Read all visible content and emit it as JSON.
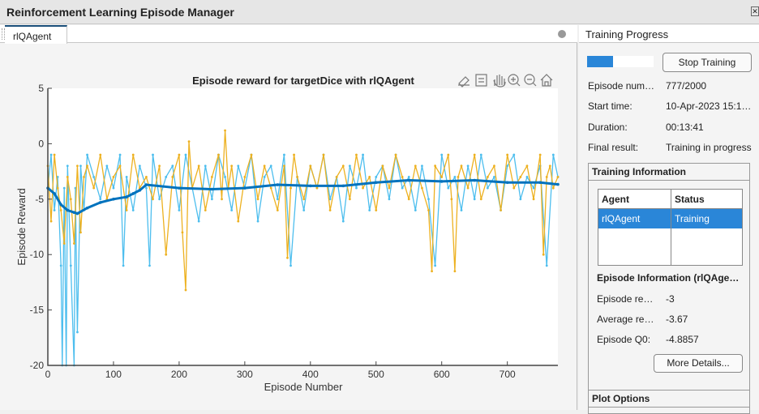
{
  "window": {
    "title": "Reinforcement Learning Episode Manager"
  },
  "tabs": [
    {
      "label": "rlQAgent",
      "active": true
    }
  ],
  "toolbar_icons": [
    "brush-icon",
    "legend-icon",
    "pan-hand-icon",
    "zoom-in-icon",
    "zoom-out-icon",
    "home-icon"
  ],
  "training_progress": {
    "header": "Training Progress",
    "progress_percent": 38.85,
    "stop_label": "Stop Training",
    "fields": [
      {
        "label": "Episode num…",
        "value": "777/2000"
      },
      {
        "label": "Start time:",
        "value": "10-Apr-2023 15:1…"
      },
      {
        "label": "Duration:",
        "value": "00:13:41"
      },
      {
        "label": "Final result:",
        "value": "Training in progress"
      }
    ],
    "training_information": {
      "header": "Training Information",
      "columns": [
        "Agent",
        "Status"
      ],
      "rows": [
        {
          "agent": "rlQAgent",
          "status": "Training",
          "selected": true
        }
      ],
      "episode_info_header": "Episode Information (rlQAge…",
      "episode_fields": [
        {
          "label": "Episode re…",
          "value": "-3"
        },
        {
          "label": "Average re…",
          "value": "-3.67"
        },
        {
          "label": "Episode Q0:",
          "value": "-4.8857"
        }
      ],
      "more_details_label": "More Details..."
    },
    "plot_options_header": "Plot Options"
  },
  "chart_data": {
    "type": "line",
    "title": "Episode reward for targetDice with rlQAgent",
    "xlabel": "Episode Number",
    "ylabel": "Episode Reward",
    "xlim": [
      0,
      777
    ],
    "ylim": [
      -20,
      5
    ],
    "xticks": [
      0,
      100,
      200,
      300,
      400,
      500,
      600,
      700
    ],
    "yticks": [
      -20,
      -15,
      -10,
      -5,
      0,
      5
    ],
    "grid": false,
    "colors": {
      "episode_reward": "#4dbeee",
      "average_reward": "#0072bd",
      "episode_q0": "#edb120"
    },
    "series": [
      {
        "key": "episode_reward",
        "x": [
          0,
          5,
          10,
          15,
          20,
          22,
          25,
          28,
          30,
          35,
          40,
          42,
          45,
          50,
          55,
          60,
          70,
          80,
          90,
          100,
          110,
          115,
          120,
          130,
          140,
          150,
          155,
          160,
          170,
          180,
          190,
          200,
          210,
          220,
          230,
          240,
          250,
          260,
          270,
          280,
          290,
          300,
          310,
          320,
          330,
          340,
          350,
          360,
          370,
          380,
          390,
          400,
          410,
          420,
          430,
          440,
          450,
          460,
          470,
          480,
          490,
          500,
          510,
          520,
          530,
          540,
          550,
          560,
          570,
          580,
          590,
          600,
          610,
          620,
          630,
          640,
          650,
          660,
          670,
          680,
          690,
          700,
          710,
          720,
          730,
          740,
          750,
          760,
          770,
          777
        ],
        "y": [
          -4,
          -1,
          -6,
          -3,
          -11,
          -20,
          -4,
          -20,
          -2,
          -11,
          -20,
          -4,
          -17,
          -2,
          -6,
          -1,
          -3,
          -5,
          -2,
          -4,
          -1,
          -11,
          -3,
          -6,
          -2,
          -4,
          -11,
          -1,
          -5,
          -3,
          -2,
          -6,
          -1,
          -4,
          -7,
          -2,
          -5,
          -1,
          -3,
          -6,
          -2,
          -4,
          -1,
          -7,
          -3,
          -2,
          -5,
          -1,
          -11,
          -3,
          -6,
          -2,
          -4,
          -1,
          -5,
          -3,
          -7,
          -2,
          -4,
          -1,
          -6,
          -3,
          -2,
          -5,
          -1,
          -4,
          -3,
          -6,
          -2,
          -5,
          -11,
          -1,
          -4,
          -3,
          -6,
          -2,
          -5,
          -1,
          -4,
          -3,
          -6,
          -2,
          -1,
          -5,
          -3,
          -4,
          -2,
          -11,
          -1,
          -3
        ]
      },
      {
        "key": "episode_q0",
        "x": [
          0,
          5,
          10,
          15,
          20,
          25,
          30,
          35,
          40,
          45,
          50,
          55,
          60,
          70,
          80,
          90,
          100,
          110,
          120,
          130,
          140,
          150,
          160,
          170,
          180,
          190,
          200,
          205,
          210,
          215,
          220,
          230,
          240,
          250,
          260,
          265,
          270,
          275,
          280,
          290,
          300,
          310,
          320,
          330,
          340,
          350,
          360,
          365,
          370,
          375,
          380,
          390,
          400,
          410,
          420,
          430,
          440,
          450,
          460,
          470,
          480,
          490,
          500,
          510,
          520,
          530,
          540,
          550,
          560,
          570,
          580,
          585,
          590,
          600,
          610,
          615,
          620,
          625,
          630,
          640,
          650,
          660,
          670,
          680,
          690,
          700,
          710,
          720,
          730,
          740,
          750,
          755,
          760,
          765,
          770,
          777
        ],
        "y": [
          -2,
          -7,
          -1,
          -4,
          -6,
          -9,
          -3,
          -5,
          -9,
          -2,
          -8,
          -3,
          -2,
          -4,
          -1,
          -5,
          -3,
          -2,
          -6,
          -1,
          -4,
          -3,
          -5,
          -2,
          -10,
          -3,
          -1,
          -8,
          -13.2,
          0.2,
          -4,
          -2,
          -6,
          -3,
          -1,
          -5,
          1.2,
          -4,
          -2,
          -7,
          -3,
          -1,
          -5,
          -2,
          -4,
          -6,
          -2,
          -10.3,
          -4,
          -1,
          -3,
          -5,
          -2,
          -4,
          -1,
          -6,
          -3,
          -2,
          -5,
          -1,
          -4,
          -3,
          -6,
          -2,
          -4,
          -1,
          -3,
          -5,
          -2,
          -4,
          -6,
          -11.5,
          -2,
          -3,
          -1,
          -5,
          -11.5,
          -3,
          -2,
          -4,
          -1,
          -5,
          -3,
          -2,
          -6,
          -1,
          -4,
          -3,
          -2,
          -5,
          -1,
          -10,
          -3,
          -2,
          -4,
          -3
        ]
      },
      {
        "key": "average_reward",
        "x": [
          0,
          10,
          20,
          30,
          40,
          45,
          60,
          80,
          100,
          120,
          130,
          140,
          150,
          200,
          250,
          300,
          350,
          400,
          450,
          500,
          550,
          600,
          650,
          700,
          750,
          777
        ],
        "y": [
          -4,
          -4.5,
          -5.5,
          -6,
          -6.2,
          -6.3,
          -5.8,
          -5.3,
          -5,
          -4.8,
          -4.5,
          -4.2,
          -3.7,
          -4,
          -4.1,
          -4,
          -3.7,
          -3.8,
          -3.8,
          -3.5,
          -3.3,
          -3.4,
          -3.3,
          -3.5,
          -3.5,
          -3.67
        ]
      }
    ]
  }
}
